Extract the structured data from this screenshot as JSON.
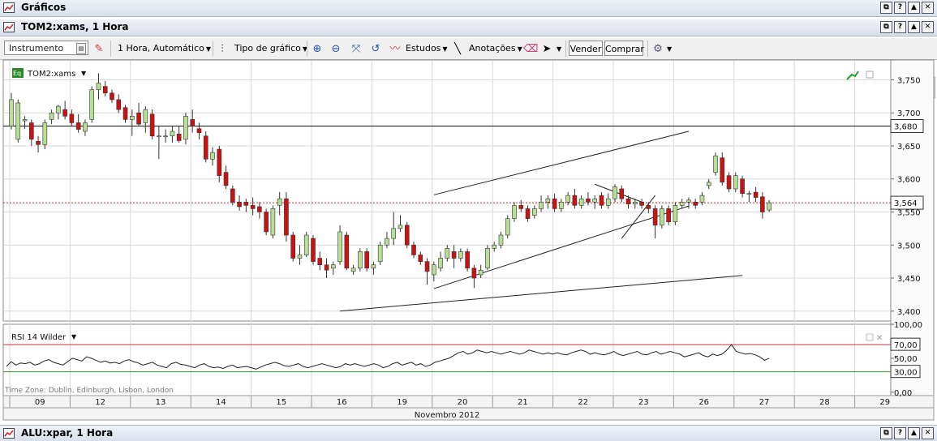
{
  "window": {
    "title": "Gráficos",
    "controls": [
      "⧉",
      "?",
      "▲",
      "✕"
    ]
  },
  "chart_window": {
    "title": "TOM2:xams, 1 Hora",
    "controls": [
      "⧉",
      "?",
      "▲",
      "✕"
    ]
  },
  "toolbar": {
    "instrument_placeholder": "Instrumento",
    "interval": "1 Hora,  Automático",
    "chart_type": "Tipo de gráfico",
    "studies": "Estudos",
    "annotations": "Anotações",
    "sell": "Vender",
    "buy": "Comprar"
  },
  "bottom_window": {
    "title": "ALU:xpar, 1 Hora",
    "controls": [
      "⧉",
      "?",
      "▲",
      "✕"
    ]
  },
  "colors": {
    "up": "#b8e094",
    "down": "#cc1111",
    "grid": "#d8d8d8",
    "rsi_upper": "#cc3333",
    "rsi_lower": "#339933",
    "current_price_line": "#cc2222"
  },
  "chart_data": [
    {
      "type": "candlestick",
      "instrument_label": "TOM2:xams",
      "ylim": [
        3.385,
        3.78
      ],
      "y_ticks": [
        "3,750",
        "3,700",
        "3,650",
        "3,600",
        "3,550",
        "3,500",
        "3,450",
        "3,400"
      ],
      "x_axis": {
        "day_labels": [
          "09",
          "12",
          "13",
          "14",
          "15",
          "16",
          "19",
          "20",
          "21",
          "22",
          "23",
          "26",
          "27",
          "28",
          "29"
        ],
        "month_label": "Novembro 2012"
      },
      "horizontal_line": {
        "value": 3.68,
        "label": "3,680"
      },
      "current_price": {
        "value": 3.564,
        "label": "3,564"
      },
      "time_zone_label": "Time Zone: Dublin, Edinburgh, Lisbon, London",
      "candles": [
        {
          "o": 3.68,
          "h": 3.73,
          "l": 3.675,
          "c": 3.72
        },
        {
          "o": 3.66,
          "h": 3.72,
          "l": 3.655,
          "c": 3.715
        },
        {
          "o": 3.688,
          "h": 3.695,
          "l": 3.676,
          "c": 3.69
        },
        {
          "o": 3.685,
          "h": 3.69,
          "l": 3.65,
          "c": 3.66
        },
        {
          "o": 3.657,
          "h": 3.665,
          "l": 3.64,
          "c": 3.652
        },
        {
          "o": 3.652,
          "h": 3.69,
          "l": 3.645,
          "c": 3.685
        },
        {
          "o": 3.69,
          "h": 3.705,
          "l": 3.683,
          "c": 3.7
        },
        {
          "o": 3.7,
          "h": 3.712,
          "l": 3.69,
          "c": 3.71
        },
        {
          "o": 3.705,
          "h": 3.718,
          "l": 3.69,
          "c": 3.695
        },
        {
          "o": 3.698,
          "h": 3.705,
          "l": 3.68,
          "c": 3.685
        },
        {
          "o": 3.685,
          "h": 3.698,
          "l": 3.67,
          "c": 3.675
        },
        {
          "o": 3.672,
          "h": 3.69,
          "l": 3.665,
          "c": 3.685
        },
        {
          "o": 3.69,
          "h": 3.74,
          "l": 3.685,
          "c": 3.735
        },
        {
          "o": 3.735,
          "h": 3.76,
          "l": 3.72,
          "c": 3.745
        },
        {
          "o": 3.74,
          "h": 3.748,
          "l": 3.725,
          "c": 3.73
        },
        {
          "o": 3.73,
          "h": 3.735,
          "l": 3.715,
          "c": 3.72
        },
        {
          "o": 3.72,
          "h": 3.728,
          "l": 3.7,
          "c": 3.705
        },
        {
          "o": 3.708,
          "h": 3.712,
          "l": 3.685,
          "c": 3.69
        },
        {
          "o": 3.69,
          "h": 3.705,
          "l": 3.665,
          "c": 3.695
        },
        {
          "o": 3.7,
          "h": 3.715,
          "l": 3.68,
          "c": 3.683
        },
        {
          "o": 3.685,
          "h": 3.71,
          "l": 3.67,
          "c": 3.705
        },
        {
          "o": 3.698,
          "h": 3.705,
          "l": 3.66,
          "c": 3.665
        },
        {
          "o": 3.665,
          "h": 3.68,
          "l": 3.63,
          "c": 3.665
        },
        {
          "o": 3.665,
          "h": 3.675,
          "l": 3.655,
          "c": 3.665
        },
        {
          "o": 3.665,
          "h": 3.68,
          "l": 3.655,
          "c": 3.672
        },
        {
          "o": 3.668,
          "h": 3.68,
          "l": 3.655,
          "c": 3.658
        },
        {
          "o": 3.66,
          "h": 3.7,
          "l": 3.652,
          "c": 3.695
        },
        {
          "o": 3.69,
          "h": 3.705,
          "l": 3.67,
          "c": 3.68
        },
        {
          "o": 3.676,
          "h": 3.685,
          "l": 3.66,
          "c": 3.67
        },
        {
          "o": 3.665,
          "h": 3.672,
          "l": 3.625,
          "c": 3.63
        },
        {
          "o": 3.63,
          "h": 3.648,
          "l": 3.62,
          "c": 3.64
        },
        {
          "o": 3.645,
          "h": 3.65,
          "l": 3.595,
          "c": 3.605
        },
        {
          "o": 3.61,
          "h": 3.62,
          "l": 3.585,
          "c": 3.59
        },
        {
          "o": 3.585,
          "h": 3.59,
          "l": 3.56,
          "c": 3.565
        },
        {
          "o": 3.565,
          "h": 3.575,
          "l": 3.552,
          "c": 3.558
        },
        {
          "o": 3.565,
          "h": 3.57,
          "l": 3.55,
          "c": 3.56
        },
        {
          "o": 3.56,
          "h": 3.572,
          "l": 3.545,
          "c": 3.555
        },
        {
          "o": 3.558,
          "h": 3.565,
          "l": 3.54,
          "c": 3.55
        },
        {
          "o": 3.55,
          "h": 3.555,
          "l": 3.515,
          "c": 3.52
        },
        {
          "o": 3.515,
          "h": 3.56,
          "l": 3.51,
          "c": 3.555
        },
        {
          "o": 3.56,
          "h": 3.58,
          "l": 3.545,
          "c": 3.57
        },
        {
          "o": 3.57,
          "h": 3.58,
          "l": 3.505,
          "c": 3.515
        },
        {
          "o": 3.515,
          "h": 3.52,
          "l": 3.475,
          "c": 3.48
        },
        {
          "o": 3.48,
          "h": 3.5,
          "l": 3.47,
          "c": 3.485
        },
        {
          "o": 3.485,
          "h": 3.52,
          "l": 3.482,
          "c": 3.515
        },
        {
          "o": 3.51,
          "h": 3.515,
          "l": 3.47,
          "c": 3.475
        },
        {
          "o": 3.48,
          "h": 3.49,
          "l": 3.462,
          "c": 3.47
        },
        {
          "o": 3.47,
          "h": 3.48,
          "l": 3.45,
          "c": 3.462
        },
        {
          "o": 3.465,
          "h": 3.475,
          "l": 3.455,
          "c": 3.47
        },
        {
          "o": 3.475,
          "h": 3.53,
          "l": 3.47,
          "c": 3.52
        },
        {
          "o": 3.515,
          "h": 3.52,
          "l": 3.462,
          "c": 3.465
        },
        {
          "o": 3.46,
          "h": 3.47,
          "l": 3.455,
          "c": 3.465
        },
        {
          "o": 3.465,
          "h": 3.495,
          "l": 3.46,
          "c": 3.49
        },
        {
          "o": 3.49,
          "h": 3.495,
          "l": 3.46,
          "c": 3.465
        },
        {
          "o": 3.465,
          "h": 3.475,
          "l": 3.455,
          "c": 3.47
        },
        {
          "o": 3.475,
          "h": 3.505,
          "l": 3.47,
          "c": 3.5
        },
        {
          "o": 3.5,
          "h": 3.52,
          "l": 3.495,
          "c": 3.51
        },
        {
          "o": 3.51,
          "h": 3.55,
          "l": 3.5,
          "c": 3.525
        },
        {
          "o": 3.525,
          "h": 3.545,
          "l": 3.52,
          "c": 3.53
        },
        {
          "o": 3.53,
          "h": 3.535,
          "l": 3.495,
          "c": 3.5
        },
        {
          "o": 3.5,
          "h": 3.505,
          "l": 3.48,
          "c": 3.485
        },
        {
          "o": 3.485,
          "h": 3.49,
          "l": 3.47,
          "c": 3.475
        },
        {
          "o": 3.475,
          "h": 3.48,
          "l": 3.44,
          "c": 3.46
        },
        {
          "o": 3.455,
          "h": 3.475,
          "l": 3.445,
          "c": 3.47
        },
        {
          "o": 3.465,
          "h": 3.49,
          "l": 3.46,
          "c": 3.48
        },
        {
          "o": 3.48,
          "h": 3.5,
          "l": 3.475,
          "c": 3.495
        },
        {
          "o": 3.49,
          "h": 3.5,
          "l": 3.465,
          "c": 3.48
        },
        {
          "o": 3.48,
          "h": 3.495,
          "l": 3.475,
          "c": 3.49
        },
        {
          "o": 3.49,
          "h": 3.495,
          "l": 3.46,
          "c": 3.465
        },
        {
          "o": 3.465,
          "h": 3.47,
          "l": 3.435,
          "c": 3.45
        },
        {
          "o": 3.455,
          "h": 3.47,
          "l": 3.45,
          "c": 3.462
        },
        {
          "o": 3.465,
          "h": 3.5,
          "l": 3.462,
          "c": 3.495
        },
        {
          "o": 3.495,
          "h": 3.505,
          "l": 3.49,
          "c": 3.5
        },
        {
          "o": 3.5,
          "h": 3.52,
          "l": 3.495,
          "c": 3.515
        },
        {
          "o": 3.515,
          "h": 3.545,
          "l": 3.51,
          "c": 3.54
        },
        {
          "o": 3.54,
          "h": 3.565,
          "l": 3.535,
          "c": 3.56
        },
        {
          "o": 3.56,
          "h": 3.568,
          "l": 3.55,
          "c": 3.555
        },
        {
          "o": 3.555,
          "h": 3.56,
          "l": 3.535,
          "c": 3.54
        },
        {
          "o": 3.545,
          "h": 3.56,
          "l": 3.54,
          "c": 3.555
        },
        {
          "o": 3.555,
          "h": 3.575,
          "l": 3.55,
          "c": 3.565
        },
        {
          "o": 3.565,
          "h": 3.575,
          "l": 3.555,
          "c": 3.57
        },
        {
          "o": 3.57,
          "h": 3.578,
          "l": 3.55,
          "c": 3.555
        },
        {
          "o": 3.555,
          "h": 3.57,
          "l": 3.55,
          "c": 3.565
        },
        {
          "o": 3.565,
          "h": 3.58,
          "l": 3.56,
          "c": 3.575
        },
        {
          "o": 3.575,
          "h": 3.585,
          "l": 3.555,
          "c": 3.56
        },
        {
          "o": 3.56,
          "h": 3.575,
          "l": 3.555,
          "c": 3.57
        },
        {
          "o": 3.57,
          "h": 3.58,
          "l": 3.56,
          "c": 3.565
        },
        {
          "o": 3.565,
          "h": 3.575,
          "l": 3.555,
          "c": 3.57
        },
        {
          "o": 3.575,
          "h": 3.58,
          "l": 3.555,
          "c": 3.56
        },
        {
          "o": 3.56,
          "h": 3.578,
          "l": 3.555,
          "c": 3.57
        },
        {
          "o": 3.57,
          "h": 3.592,
          "l": 3.565,
          "c": 3.588
        },
        {
          "o": 3.585,
          "h": 3.59,
          "l": 3.565,
          "c": 3.57
        },
        {
          "o": 3.57,
          "h": 3.575,
          "l": 3.555,
          "c": 3.562
        },
        {
          "o": 3.562,
          "h": 3.57,
          "l": 3.555,
          "c": 3.565
        },
        {
          "o": 3.565,
          "h": 3.57,
          "l": 3.555,
          "c": 3.56
        },
        {
          "o": 3.56,
          "h": 3.565,
          "l": 3.548,
          "c": 3.555
        },
        {
          "o": 3.555,
          "h": 3.56,
          "l": 3.51,
          "c": 3.53
        },
        {
          "o": 3.53,
          "h": 3.56,
          "l": 3.525,
          "c": 3.555
        },
        {
          "o": 3.555,
          "h": 3.56,
          "l": 3.53,
          "c": 3.535
        },
        {
          "o": 3.535,
          "h": 3.565,
          "l": 3.53,
          "c": 3.56
        },
        {
          "o": 3.56,
          "h": 3.57,
          "l": 3.555,
          "c": 3.565
        },
        {
          "o": 3.565,
          "h": 3.572,
          "l": 3.555,
          "c": 3.568
        },
        {
          "o": 3.565,
          "h": 3.57,
          "l": 3.555,
          "c": 3.56
        },
        {
          "o": 3.565,
          "h": 3.58,
          "l": 3.56,
          "c": 3.575
        },
        {
          "o": 3.59,
          "h": 3.6,
          "l": 3.585,
          "c": 3.595
        },
        {
          "o": 3.61,
          "h": 3.64,
          "l": 3.605,
          "c": 3.635
        },
        {
          "o": 3.632,
          "h": 3.64,
          "l": 3.59,
          "c": 3.595
        },
        {
          "o": 3.605,
          "h": 3.61,
          "l": 3.58,
          "c": 3.585
        },
        {
          "o": 3.585,
          "h": 3.61,
          "l": 3.58,
          "c": 3.605
        },
        {
          "o": 3.6,
          "h": 3.605,
          "l": 3.572,
          "c": 3.578
        },
        {
          "o": 3.578,
          "h": 3.582,
          "l": 3.565,
          "c": 3.578
        },
        {
          "o": 3.58,
          "h": 3.588,
          "l": 3.565,
          "c": 3.572
        },
        {
          "o": 3.573,
          "h": 3.58,
          "l": 3.54,
          "c": 3.55
        },
        {
          "o": 3.553,
          "h": 3.568,
          "l": 3.55,
          "c": 3.564
        }
      ],
      "trendlines": [
        {
          "from": [
            0,
            3.576
          ],
          "to": [
            38,
            3.672
          ]
        },
        {
          "from": [
            0,
            3.434
          ],
          "to": [
            38,
            3.559
          ]
        },
        {
          "from": [
            24,
            3.592
          ],
          "to": [
            31,
            3.565
          ]
        },
        {
          "from": [
            28,
            3.51
          ],
          "to": [
            33,
            3.575
          ]
        },
        {
          "from": [
            -14,
            3.4
          ],
          "to": [
            46,
            3.454
          ]
        }
      ]
    },
    {
      "type": "line",
      "title": "RSI 14 Wilder",
      "ylim": [
        -5,
        100
      ],
      "y_ticks": [
        "100,00",
        "70,00",
        "50,00",
        "30,00",
        "0,00"
      ],
      "y_tick_values": [
        100,
        70,
        50,
        30,
        0
      ],
      "levels": [
        70,
        30
      ],
      "values": [
        38,
        45,
        40,
        43,
        42,
        44,
        40,
        42,
        46,
        48,
        44,
        42,
        40,
        45,
        50,
        48,
        46,
        52,
        50,
        47,
        44,
        46,
        43,
        44,
        42,
        46,
        48,
        45,
        43,
        40,
        42,
        44,
        40,
        38,
        36,
        42,
        44,
        41,
        40,
        38,
        36,
        40,
        42,
        38,
        36,
        37,
        35,
        38,
        40,
        36,
        37,
        38,
        36,
        34,
        37,
        40,
        42,
        44,
        42,
        39,
        38,
        40,
        42,
        38,
        36,
        38,
        40,
        42,
        40,
        38,
        36,
        38,
        42,
        40,
        42,
        40,
        38,
        40,
        42,
        40,
        36,
        38,
        42,
        44,
        40,
        42,
        44,
        40,
        42,
        38,
        40,
        44,
        46,
        48,
        50,
        54,
        58,
        60,
        56,
        58,
        62,
        60,
        58,
        60,
        58,
        56,
        58,
        60,
        58,
        56,
        58,
        62,
        60,
        58,
        56,
        58,
        56,
        58,
        56,
        55,
        58,
        60,
        62,
        60,
        56,
        58,
        56,
        55,
        57,
        60,
        56,
        54,
        56,
        58,
        60,
        56,
        55,
        58,
        60,
        56,
        58,
        60,
        58,
        56,
        52,
        54,
        56,
        58,
        54,
        52,
        56,
        54,
        56,
        62,
        70,
        60,
        58,
        56,
        57,
        55,
        52,
        47,
        50
      ],
      "x_day_labels": [
        "09",
        "12",
        "13",
        "14",
        "15",
        "16",
        "19",
        "20",
        "21",
        "22",
        "23",
        "26",
        "27",
        "28",
        "29"
      ]
    }
  ]
}
